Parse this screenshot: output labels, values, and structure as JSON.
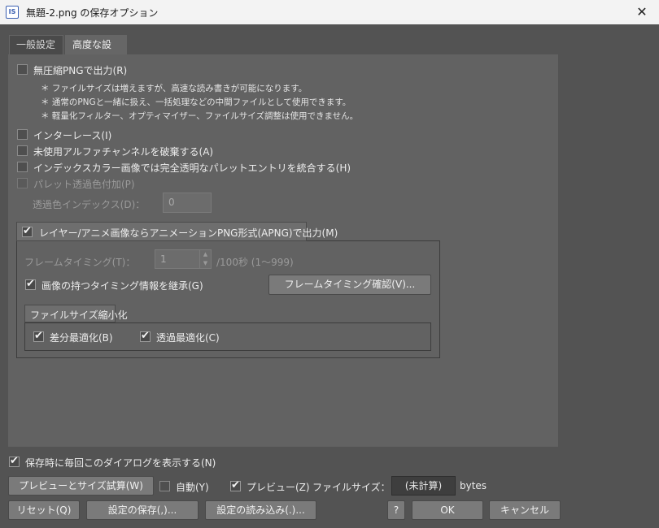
{
  "window": {
    "title": "無題-2.png の保存オプション",
    "icon": "IS",
    "close_glyph": "✕"
  },
  "tabs": [
    {
      "label": "一般設定"
    },
    {
      "label": "高度な設定"
    }
  ],
  "uncompressed": {
    "label": "無圧縮PNGで出力(R)",
    "notes": [
      "＊ ファイルサイズは増えますが、高速な読み書きが可能になります。",
      "＊ 通常のPNGと一緒に扱え、一括処理などの中間ファイルとして使用できます。",
      "＊ 軽量化フィルター、オプティマイザー、ファイルサイズ調整は使用できません。"
    ]
  },
  "interlace_label": "インターレース(I)",
  "discard_alpha_label": "未使用アルファチャンネルを破棄する(A)",
  "merge_palette_label": "インデックスカラー画像では完全透明なパレットエントリを統合する(H)",
  "palette_transparent_label": "パレット透過色付加(P)",
  "transparent_index": {
    "label": "透過色インデックス(D)：",
    "value": "0"
  },
  "apng": {
    "label": "レイヤー/アニメ画像ならアニメーションPNG形式(APNG)で出力(M)",
    "frame_timing_label": "フレームタイミング(T)：",
    "frame_timing_value": "1",
    "frame_timing_unit": "/100秒 (1～999)",
    "inherit_label": "画像の持つタイミング情報を継承(G)",
    "confirm_button": "フレームタイミング確認(V)...",
    "filesize_group": "ファイルサイズ縮小化",
    "diff_opt_label": "差分最適化(B)",
    "transp_opt_label": "透過最適化(C)"
  },
  "footer": {
    "show_dialog_label": "保存時に毎回このダイアログを表示する(N)",
    "preview_size_button": "プレビューとサイズ試算(W)",
    "auto_label": "自動(Y)",
    "preview_label": "プレビュー(Z)",
    "filesize_label": "ファイルサイズ：",
    "filesize_value": "(未計算)",
    "filesize_unit": "bytes",
    "reset_button": "リセット(Q)",
    "save_settings_button": "設定の保存(,)...",
    "load_settings_button": "設定の読み込み(.)...",
    "help_button": "?",
    "ok_button": "OK",
    "cancel_button": "キャンセル"
  }
}
